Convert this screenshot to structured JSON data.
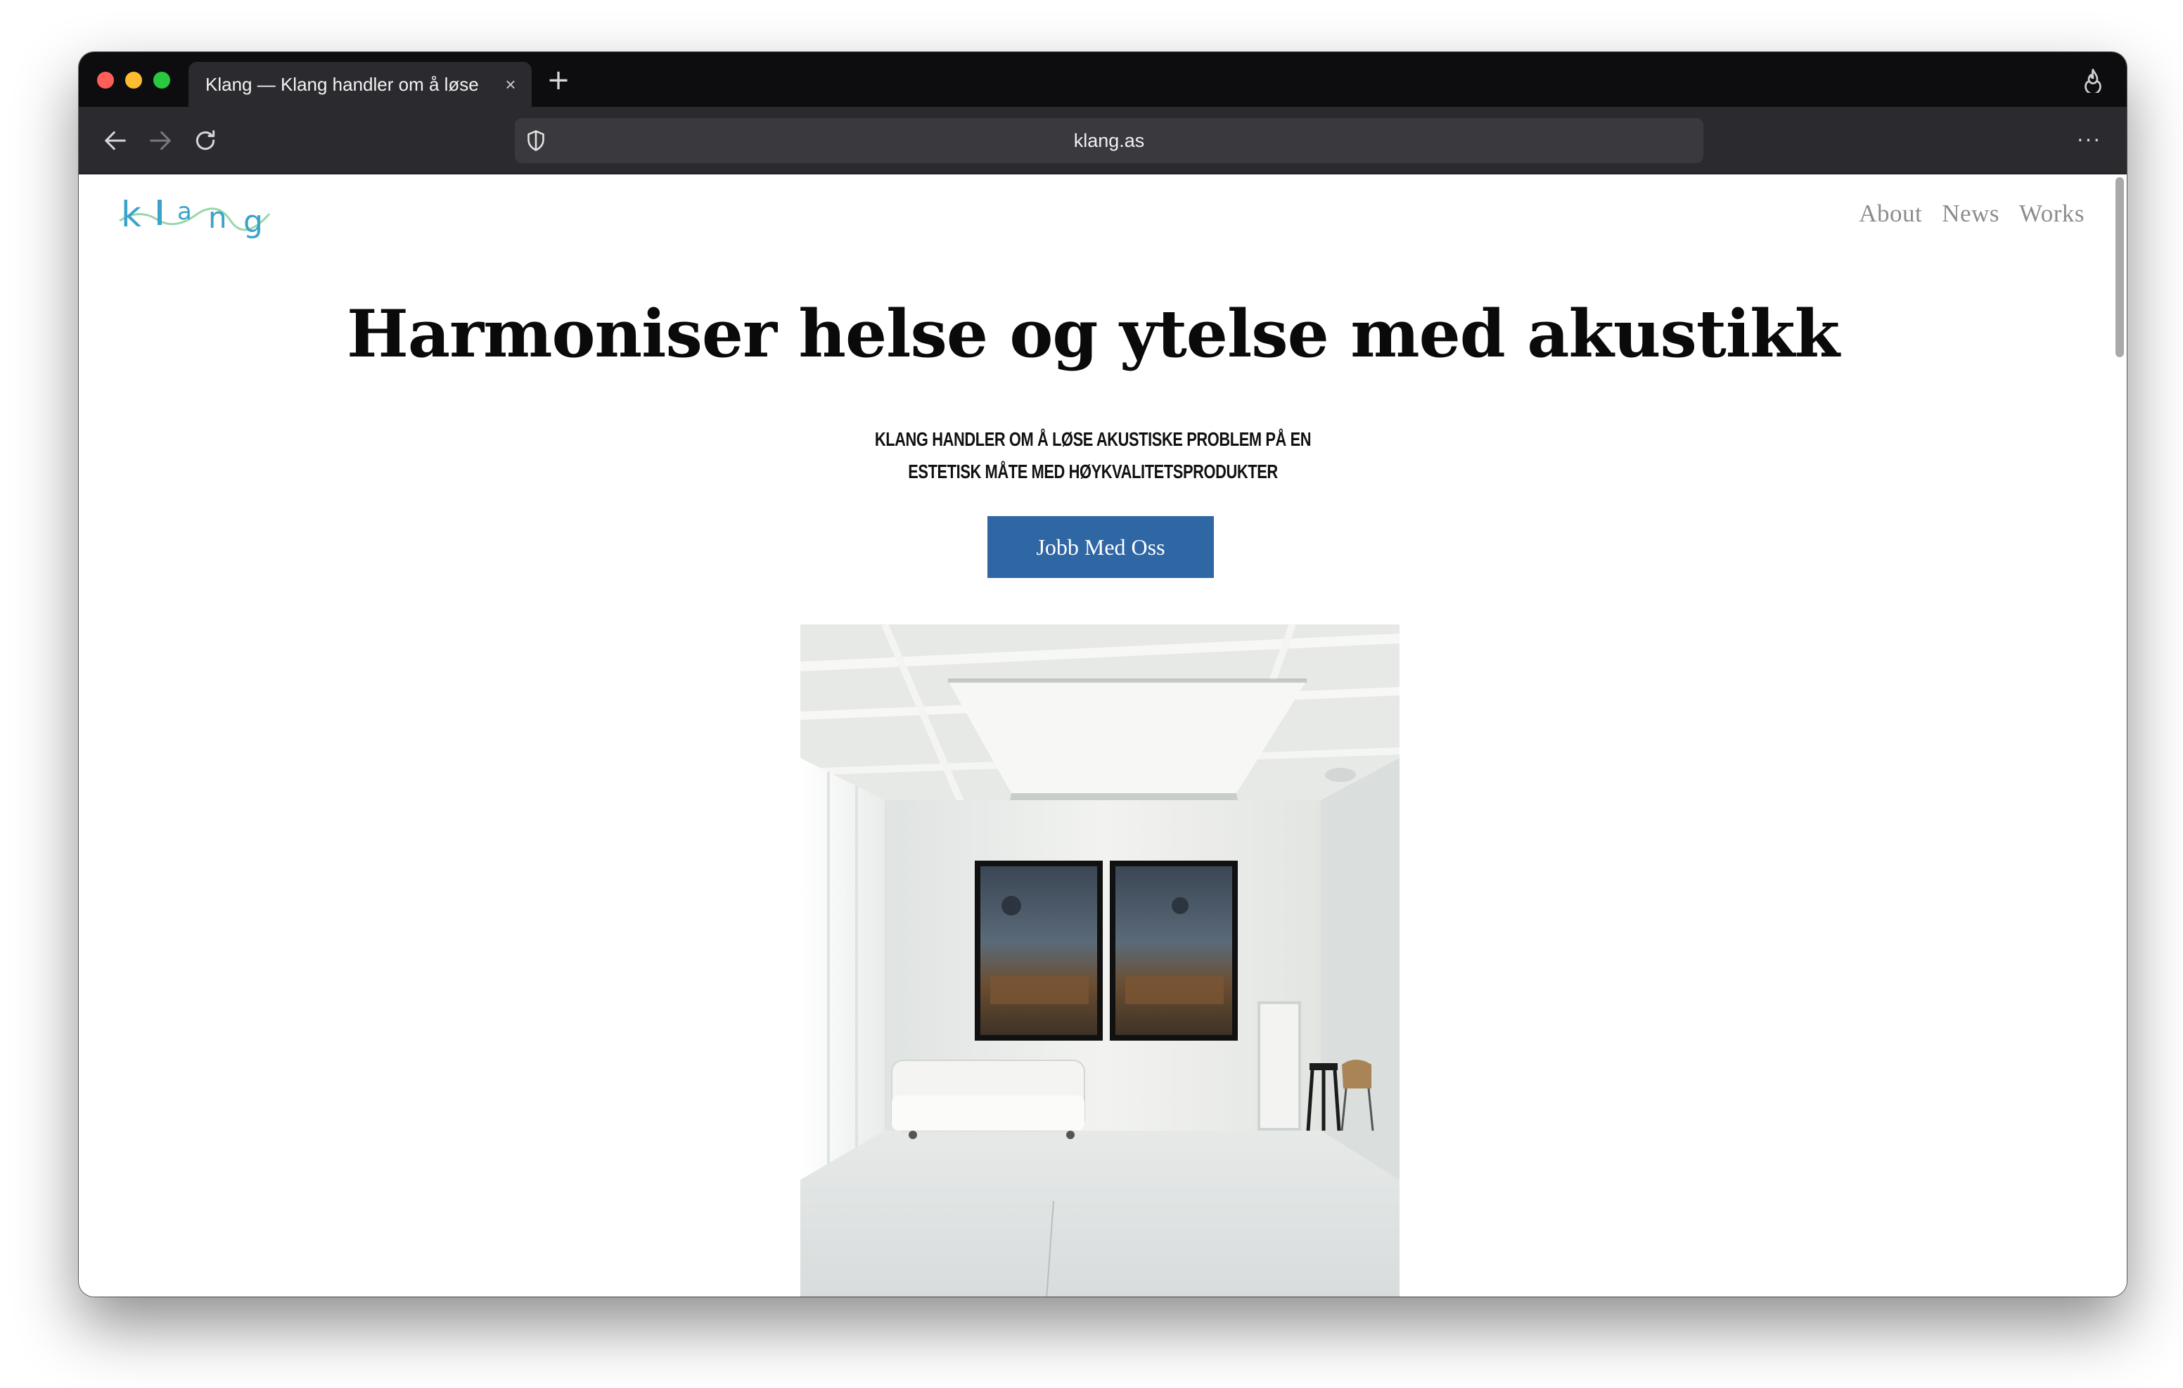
{
  "browser": {
    "tab_title": "Klang — Klang handler om å løse",
    "tab_close": "×",
    "new_tab": "+",
    "url": "klang.as",
    "menu": "···"
  },
  "site": {
    "logo_text": "klang",
    "nav": [
      {
        "label": "About"
      },
      {
        "label": "News"
      },
      {
        "label": "Works"
      }
    ],
    "headline": "Harmoniser helse og ytelse med akustikk",
    "tagline_line1": "Klang handler om å løse akustiske problem på en",
    "tagline_line2": "estetisk måte med høykvalitetsprodukter",
    "cta_label": "Jobb Med Oss"
  },
  "colors": {
    "brand_blue": "#2f66a4",
    "logo_blue": "#3aa3c9",
    "logo_green": "#8fd3a0"
  },
  "icons": [
    "back-arrow-icon",
    "forward-arrow-icon",
    "reload-icon",
    "shield-icon",
    "flame-icon",
    "more-icon",
    "close-icon",
    "plus-icon"
  ]
}
